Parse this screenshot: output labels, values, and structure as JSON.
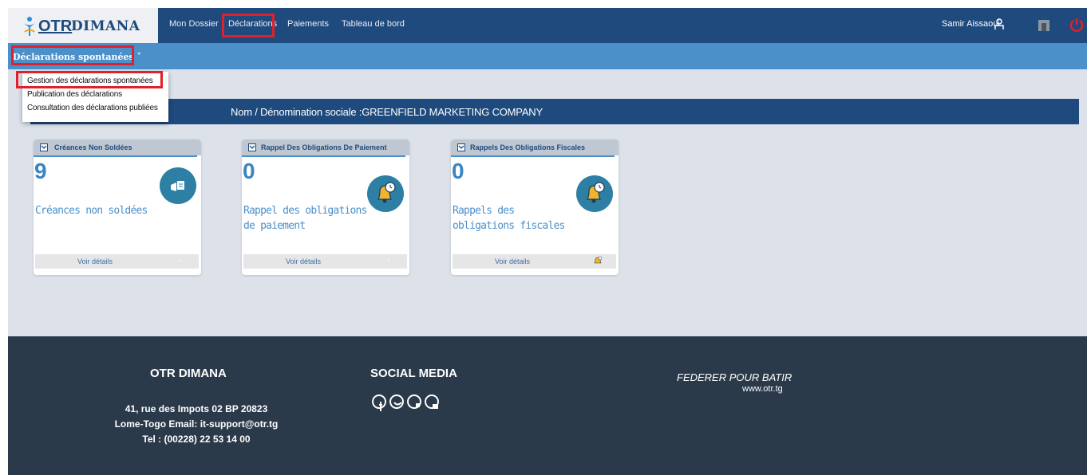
{
  "brand": {
    "logo_text": "OTR",
    "app_name": "DIMANA"
  },
  "nav": {
    "items": [
      "Mon Dossier",
      "Déclarations",
      "Paiements",
      "Tableau de bord"
    ],
    "active": "Déclarations"
  },
  "user": {
    "name": "Samir  Aissaoui"
  },
  "subnav": {
    "label": "Déclarations spontanées ˅"
  },
  "dropdown": {
    "items": [
      "Gestion des déclarations spontanées",
      "Publication des déclarations",
      "Consultation des déclarations publiées"
    ]
  },
  "banner": {
    "text": "Nom / Dénomination sociale :GREENFIELD MARKETING COMPANY"
  },
  "cards": [
    {
      "title": "Créances Non Soldées",
      "count": "9",
      "description": "Créances non soldées",
      "link": "Voir détails",
      "icon": "hand-document-icon"
    },
    {
      "title": "Rappel Des Obligations De Paiement",
      "count": "0",
      "description": "Rappel des obligations de paiement",
      "link": "Voir détails",
      "icon": "bell-clock-icon"
    },
    {
      "title": "Rappels Des Obligations Fiscales",
      "count": "0",
      "description": "Rappels des obligations fiscales",
      "link": "Voir détails",
      "icon": "bell-clock-icon"
    }
  ],
  "footer": {
    "col1_title": "OTR DIMANA",
    "address": "41, rue des Impots 02 BP 20823 Lome-Togo Email: it-support@otr.tg Tel : (00228) 22 53 14 00",
    "col2_title": "SOCIAL MEDIA",
    "social_icons": [
      "facebook-icon",
      "twitter-icon",
      "linkedin-icon",
      "youtube-icon"
    ],
    "motto": "FEDERER POUR BATIR",
    "website": "www.otr.tg"
  },
  "colors": {
    "topbar": "#1e4a7e",
    "subbar": "#4b90c9",
    "highlight": "#e0202a",
    "card_icon": "#2d7fa3",
    "footer": "#2b3a4a",
    "power": "#e0202a"
  }
}
